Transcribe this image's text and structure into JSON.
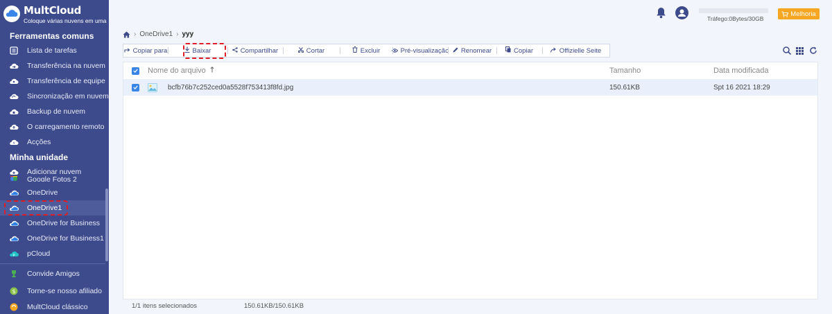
{
  "brand": {
    "name": "MultCloud",
    "tagline": "Coloque várias nuvens em uma"
  },
  "sidebar": {
    "section_tools": "Ferramentas comuns",
    "tools": [
      {
        "label": "Lista de tarefas",
        "icon": "list-icon"
      },
      {
        "label": "Transferência na nuvem",
        "icon": "cloud-transfer-icon"
      },
      {
        "label": "Transferência de equipe",
        "icon": "team-transfer-icon"
      },
      {
        "label": "Sincronização em nuvem",
        "icon": "cloud-sync-icon"
      },
      {
        "label": "Backup de nuvem",
        "icon": "cloud-backup-icon"
      },
      {
        "label": "O carregamento remoto",
        "icon": "remote-upload-icon"
      },
      {
        "label": "Acções",
        "icon": "actions-icon"
      }
    ],
    "section_drive": "Minha unidade",
    "add_cloud": "Adicionar nuvem",
    "partial_item": "Google Fotos 2",
    "clouds": [
      {
        "label": "OneDrive",
        "icon": "onedrive-icon"
      },
      {
        "label": "OneDrive1",
        "icon": "onedrive-icon",
        "active": true
      },
      {
        "label": "OneDrive for Business",
        "icon": "onedrive-icon"
      },
      {
        "label": "OneDrive for Business1",
        "icon": "onedrive-icon"
      },
      {
        "label": "pCloud",
        "icon": "pcloud-icon"
      }
    ],
    "extras": [
      {
        "label": "Convide Amigos",
        "icon": "trophy-icon"
      },
      {
        "label": "Torne-se nosso afiliado",
        "icon": "dollar-icon"
      },
      {
        "label": "MultCloud clássico",
        "icon": "classic-icon"
      }
    ]
  },
  "topbar": {
    "traffic_label": "Tráfego:0Bytes/30GB",
    "traffic_used_fraction": 0,
    "upgrade_label": "Melhoria"
  },
  "breadcrumb": {
    "parent": "OneDrive1",
    "current": "yyy"
  },
  "toolbar": {
    "copy_to": "Copiar para",
    "download": "Baixar",
    "share": "Compartilhar",
    "cut": "Cortar",
    "delete": "Excluir",
    "preview": "Pré-visualização",
    "rename": "Renomear",
    "copy": "Copiar",
    "office": "Offizielle Seite"
  },
  "table": {
    "columns": {
      "name": "Nome do arquivo",
      "size": "Tamanho",
      "date": "Data modificada"
    },
    "rows": [
      {
        "name": "bcfb76b7c252ced0a5528f753413f8fd.jpg",
        "size": "150.61KB",
        "date": "Spt 16 2021 18:29",
        "selected": true
      }
    ]
  },
  "status": {
    "selected": "1/1 itens selecionados",
    "size": "150.61KB/150.61KB"
  },
  "colors": {
    "sidebar": "#3d4a8c",
    "accent": "#3a86e8",
    "highlight": "#e01c24",
    "upgrade": "#f5a623"
  }
}
